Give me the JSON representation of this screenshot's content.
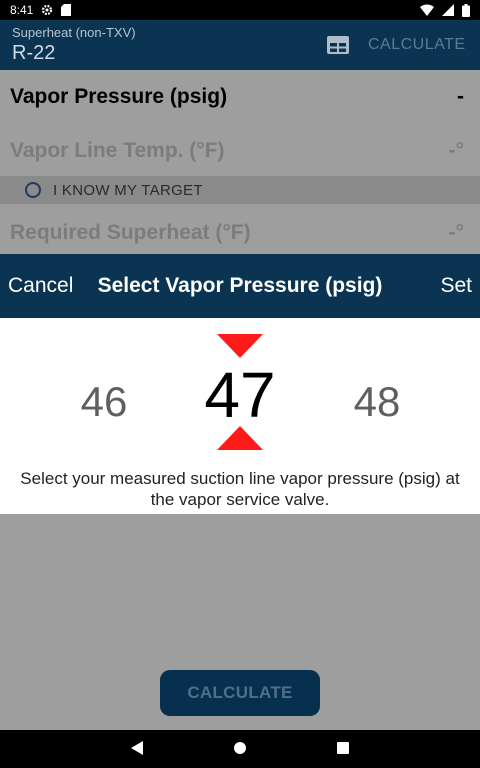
{
  "status_bar": {
    "time": "8:41"
  },
  "app_bar": {
    "subtitle": "Superheat (non-TXV)",
    "title": "R-22",
    "calculate_label": "CALCULATE"
  },
  "fields": {
    "vapor_pressure": {
      "label": "Vapor Pressure (psig)",
      "value": "-"
    },
    "vapor_line_temp": {
      "label": "Vapor Line Temp. (°F)",
      "value": "-°"
    },
    "target_option": {
      "label": "I KNOW MY TARGET"
    },
    "required_superheat": {
      "label": "Required Superheat (°F)",
      "value": "-°"
    }
  },
  "dialog": {
    "cancel_label": "Cancel",
    "title": "Select Vapor Pressure (psig)",
    "set_label": "Set",
    "picker": {
      "previous": "46",
      "current": "47",
      "next": "48"
    },
    "description": "Select your measured suction line vapor pressure (psig) at the vapor service valve."
  },
  "bottom_button": {
    "label": "CALCULATE"
  },
  "colors": {
    "primary": "#0a3452",
    "accent_arrow": "#ff1a1a",
    "scrim": "#9e9e9e"
  }
}
